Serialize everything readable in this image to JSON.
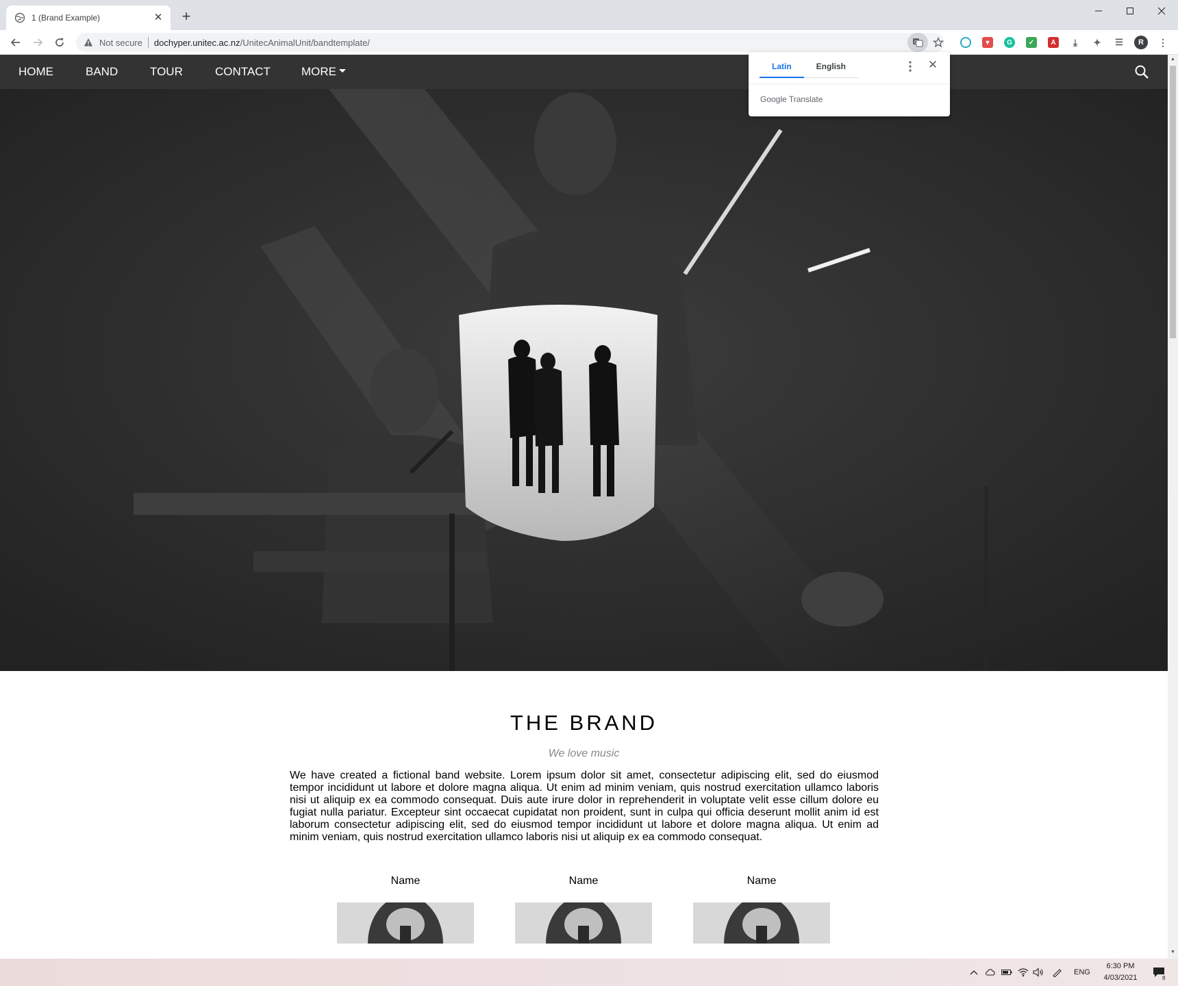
{
  "browser": {
    "tab_title": "1 (Brand Example)",
    "address": {
      "security_label": "Not secure",
      "host": "dochyper.unitec.ac.nz",
      "path": "/UnitecAnimalUnit/bandtemplate/"
    },
    "profile_initial": "R"
  },
  "translate_popup": {
    "source_lang": "Latin",
    "target_lang": "English",
    "brand_google": "Google",
    "brand_translate": "Translate"
  },
  "site": {
    "nav": {
      "home": "HOME",
      "band": "BAND",
      "tour": "TOUR",
      "contact": "CONTACT",
      "more": "MORE"
    },
    "brand_section": {
      "title": "THE BRAND",
      "subtitle": "We love music",
      "body": "We have created a fictional band website. Lorem ipsum dolor sit amet, consectetur adipiscing elit, sed do eiusmod tempor incididunt ut labore et dolore magna aliqua. Ut enim ad minim veniam, quis nostrud exercitation ullamco laboris nisi ut aliquip ex ea commodo consequat. Duis aute irure dolor in reprehenderit in voluptate velit esse cillum dolore eu fugiat nulla pariatur. Excepteur sint occaecat cupidatat non proident, sunt in culpa qui officia deserunt mollit anim id est laborum consectetur adipiscing elit, sed do eiusmod tempor incididunt ut labore et dolore magna aliqua. Ut enim ad minim veniam, quis nostrud exercitation ullamco laboris nisi ut aliquip ex ea commodo consequat."
    },
    "members": [
      {
        "name": "Name"
      },
      {
        "name": "Name"
      },
      {
        "name": "Name"
      }
    ]
  },
  "taskbar": {
    "language": "ENG",
    "time": "6:30 PM",
    "date": "4/03/2021",
    "notification_count": "8"
  }
}
